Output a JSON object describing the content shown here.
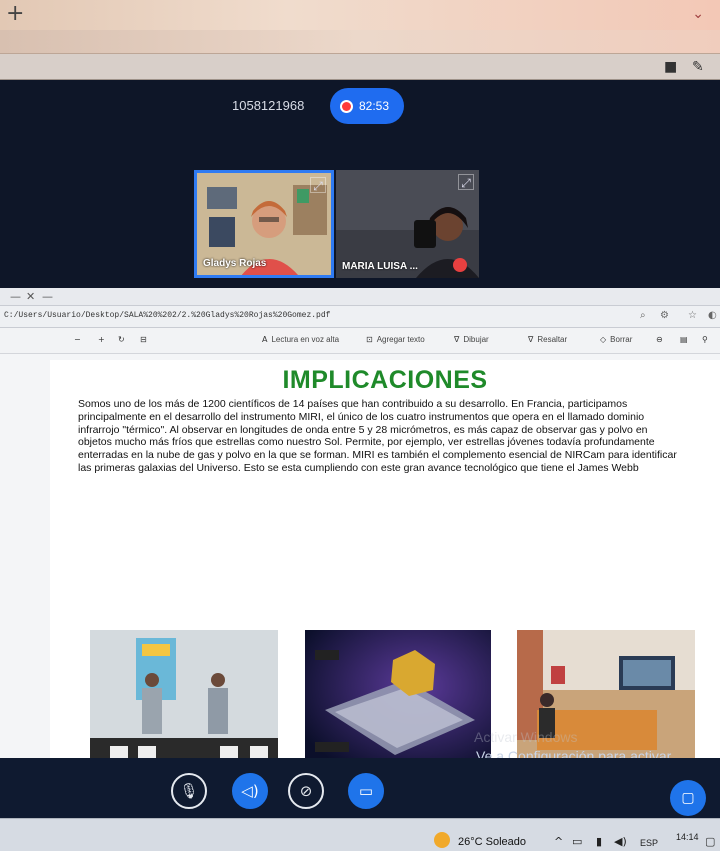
{
  "call": {
    "meeting_id": "1058121968",
    "recording_time": "82:53",
    "participants": [
      {
        "name": "Gladys Rojas"
      },
      {
        "name": "MARIA LUISA ..."
      }
    ]
  },
  "document": {
    "path": "C:/Users/Usuario/Desktop/SALA%20%202/2.%20Gladys%20Rojas%20Gomez.pdf",
    "toolbar": {
      "read_aloud": "Lectura en voz alta",
      "add_text": "Agregar texto",
      "draw": "Dibujar",
      "highlight": "Resaltar",
      "erase": "Borrar"
    },
    "page": {
      "title": "IMPLICACIONES",
      "paragraph": "Somos uno de los más de 1200 científicos de 14 países que han contribuido a su desarrollo. En Francia, participamos principalmente en el desarrollo del instrumento MIRI, el único de los cuatro instrumentos que opera en el llamado dominio infrarrojo \"térmico\". Al observar en longitudes de onda entre 5 y 28 micrómetros, es más capaz de observar gas y polvo en objetos mucho más fríos que estrellas como nuestro Sol. Permite, por ejemplo, ver estrellas jóvenes todavía profundamente enterradas en la nube de gas y polvo en la que se forman. MIRI es también el complemento esencial de NIRCam para identificar las primeras galaxias del Universo. Esto se esta cumpliendo con este gran avance tecnológico que tiene el James Webb"
    }
  },
  "system": {
    "activate_windows": "Ve a Configuración para activar Windows",
    "activate_windows_title": "Activar Windows",
    "weather": "26°C  Soleado",
    "language": "ESP",
    "time": "14:14"
  },
  "colors": {
    "accent": "#1f74ea",
    "title_green": "#1f8a2a",
    "record": "#ff3b3b"
  }
}
